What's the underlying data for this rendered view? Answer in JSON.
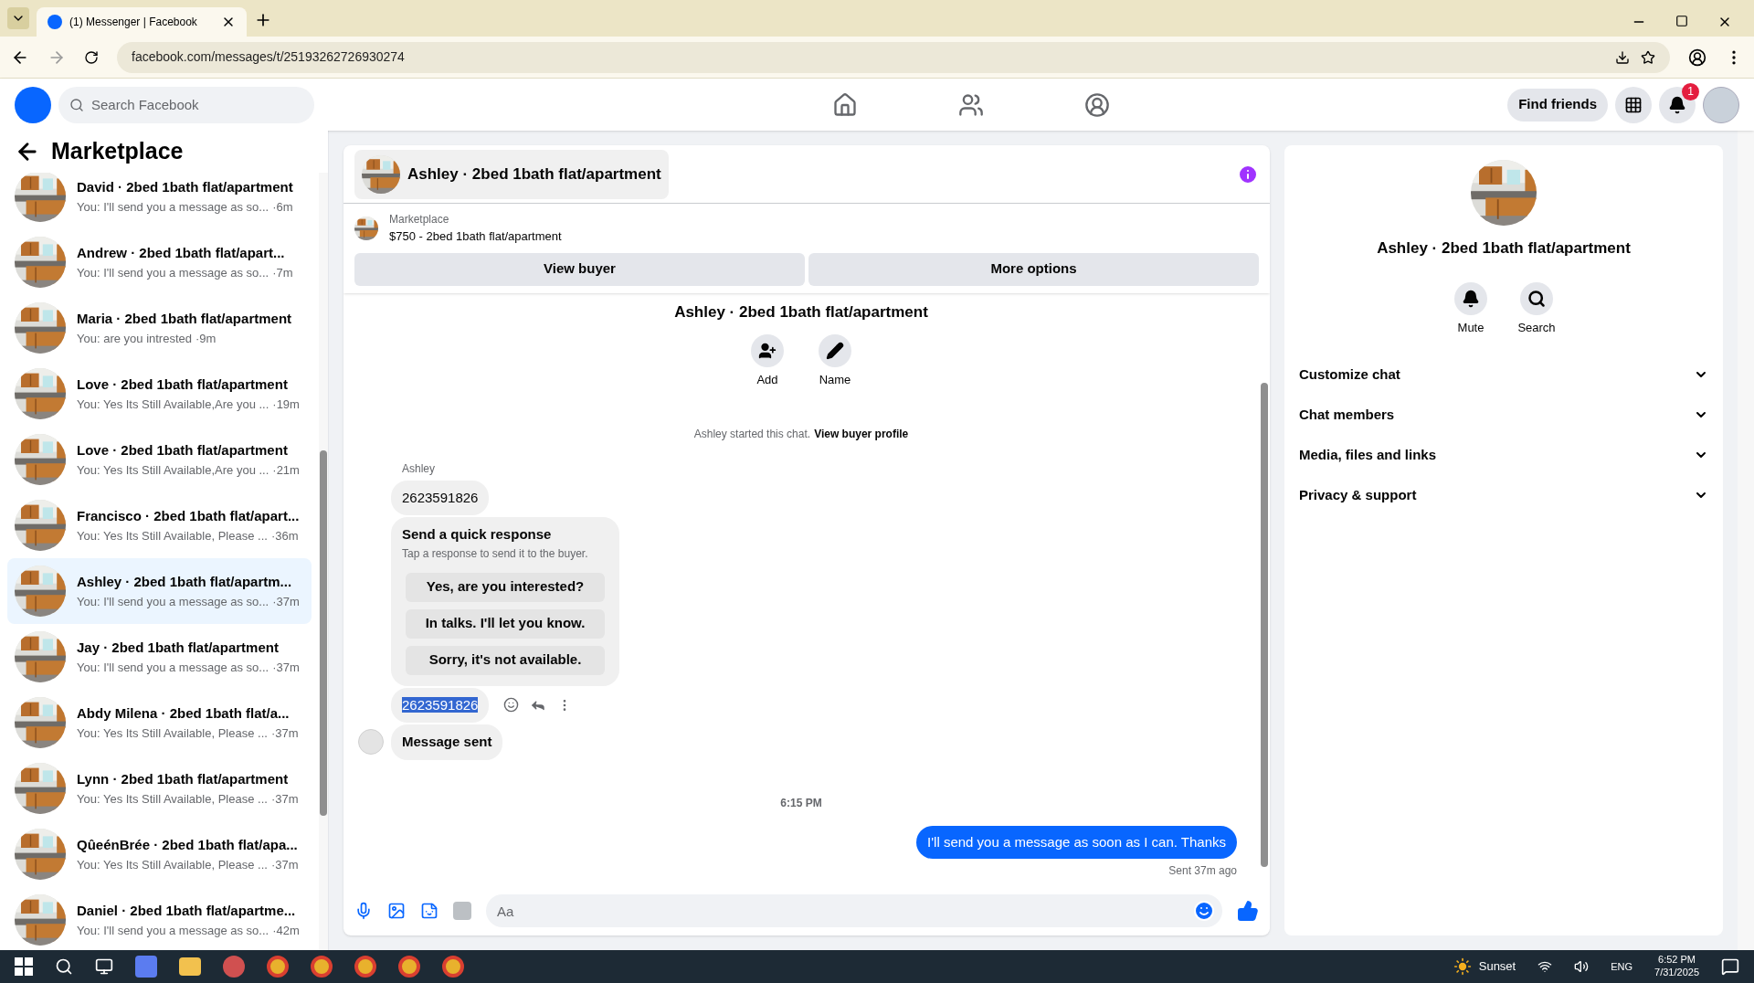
{
  "browser": {
    "tab_title": "(1) Messenger | Facebook",
    "url": "facebook.com/messages/t/25193262726930274"
  },
  "header": {
    "search_placeholder": "Search Facebook",
    "find_friends": "Find friends",
    "notification_count": "1"
  },
  "sidebar": {
    "title": "Marketplace",
    "conversations": [
      {
        "title": "David · 2bed 1bath flat/apartment",
        "preview": "You: I'll send you a message as so...",
        "time": "·6m",
        "selected": false
      },
      {
        "title": "Andrew · 2bed 1bath flat/apart...",
        "preview": "You: I'll send you a message as so...",
        "time": "·7m",
        "selected": false
      },
      {
        "title": "Maria · 2bed 1bath flat/apartment",
        "preview": "You: are you intrested",
        "time": "·9m",
        "selected": false
      },
      {
        "title": "Love · 2bed 1bath flat/apartment",
        "preview": "You: Yes Its Still Available,Are you ...",
        "time": "·19m",
        "selected": false
      },
      {
        "title": "Love · 2bed 1bath flat/apartment",
        "preview": "You: Yes Its Still Available,Are you ...",
        "time": "·21m",
        "selected": false
      },
      {
        "title": "Francisco · 2bed 1bath flat/apart...",
        "preview": "You: Yes Its Still Available, Please ...",
        "time": "·36m",
        "selected": false
      },
      {
        "title": "Ashley · 2bed 1bath flat/apartm...",
        "preview": "You: I'll send you a message as so...",
        "time": "·37m",
        "selected": true
      },
      {
        "title": "Jay · 2bed 1bath flat/apartment",
        "preview": "You: I'll send you a message as so...",
        "time": "·37m",
        "selected": false
      },
      {
        "title": "Abdy Milena · 2bed 1bath flat/a...",
        "preview": "You: Yes Its Still Available, Please ...",
        "time": "·37m",
        "selected": false
      },
      {
        "title": "Lynn · 2bed 1bath flat/apartment",
        "preview": "You: Yes Its Still Available, Please ...",
        "time": "·37m",
        "selected": false
      },
      {
        "title": "QûeénBrée · 2bed 1bath flat/apa...",
        "preview": "You: Yes Its Still Available, Please ...",
        "time": "·37m",
        "selected": false
      },
      {
        "title": "Daniel · 2bed 1bath flat/apartme...",
        "preview": "You: I'll send you a message as so...",
        "time": "·42m",
        "selected": false
      }
    ]
  },
  "chat": {
    "title": "Ashley · 2bed 1bath flat/apartment",
    "listing": {
      "source": "Marketplace",
      "item": "$750 - 2bed 1bath flat/apartment"
    },
    "buttons": [
      "View buyer",
      "More options"
    ],
    "profile_name": "Ashley · 2bed 1bath flat/apartment",
    "actions": [
      {
        "kind": "add",
        "label": "Add"
      },
      {
        "kind": "name",
        "label": "Name"
      }
    ],
    "notice": "Ashley started this chat.",
    "notice_link": "View buyer profile",
    "messages": [
      {
        "kind": "sender",
        "text": "Ashley"
      },
      {
        "kind": "incoming",
        "text": "2623591826",
        "highlighted": false
      },
      {
        "kind": "quick_response",
        "title": "Send a quick response",
        "subtitle": "Tap a response to send it to the buyer.",
        "options": [
          "Yes, are you interested?",
          "In talks. I'll let you know.",
          "Sorry, it's not available."
        ]
      },
      {
        "kind": "incoming",
        "text": "2623591826",
        "highlighted": true
      },
      {
        "kind": "incoming",
        "text": "Message sent",
        "highlighted": false,
        "avatar": true
      },
      {
        "kind": "timestamp",
        "text": "6:15 PM"
      },
      {
        "kind": "outgoing",
        "text": "I'll send you a message as soon as I can. Thanks"
      },
      {
        "kind": "status",
        "text": "Sent 37m ago"
      }
    ],
    "composer_placeholder": "Aa"
  },
  "details": {
    "name": "Ashley · 2bed 1bath flat/apartment",
    "actions": [
      {
        "kind": "mute",
        "label": "Mute"
      },
      {
        "kind": "search",
        "label": "Search"
      }
    ],
    "sections": [
      {
        "label": "Customize chat",
        "expanded": false
      },
      {
        "label": "Chat members",
        "expanded": false
      },
      {
        "label": "Media, files and links",
        "expanded": false
      },
      {
        "label": "Privacy & support",
        "expanded": false
      }
    ]
  },
  "taskbar": {
    "weather": "Sunset",
    "language": "ENG",
    "time": "6:52 PM",
    "date": "7/31/2025"
  }
}
